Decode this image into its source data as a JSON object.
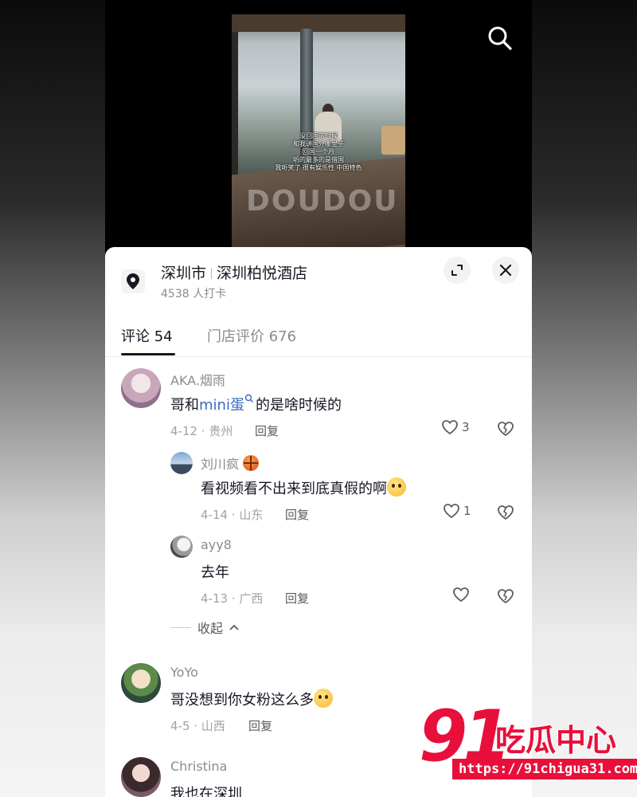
{
  "video": {
    "captions": [
      "没回国的时候",
      "和我讲国外哪里子",
      "回国一个月",
      "听的最多的是借国",
      "我听笑了 很有娱乐性 中国特色"
    ],
    "watermark": "DOUDOU"
  },
  "location": {
    "city": "深圳市",
    "place": "深圳柏悦酒店",
    "checkins": "4538 人打卡"
  },
  "tabs": [
    {
      "label": "评论 54"
    },
    {
      "label": "门店评价 676"
    }
  ],
  "comments": [
    {
      "user": "AKA.烟雨",
      "text_before": "哥和",
      "link": "mini蛋",
      "text_after": "的是啥时候的",
      "meta": "4-12 · 贵州",
      "reply": "回复",
      "likes": "3"
    },
    {
      "user": "刘川疯",
      "text": "看视频看不出来到底真假的啊",
      "meta": "4-14 · 山东",
      "reply": "回复",
      "likes": "1"
    },
    {
      "user": "ayy8",
      "text": "去年",
      "meta": "4-13 · 广西",
      "reply": "回复"
    },
    {
      "user": "YoYo",
      "text": "哥没想到你女粉这么多",
      "meta": "4-5 · 山西",
      "reply": "回复"
    },
    {
      "user": "Christina",
      "text": "我也在深圳"
    }
  ],
  "collapse_label": "收起",
  "brand": {
    "number": "91",
    "name": "吃瓜中心",
    "url": "https://91chigua31.com"
  },
  "colors": {
    "accent": "#e8103b",
    "link": "#3a6bbd",
    "text": "#161823",
    "muted": "#8a8b91"
  }
}
